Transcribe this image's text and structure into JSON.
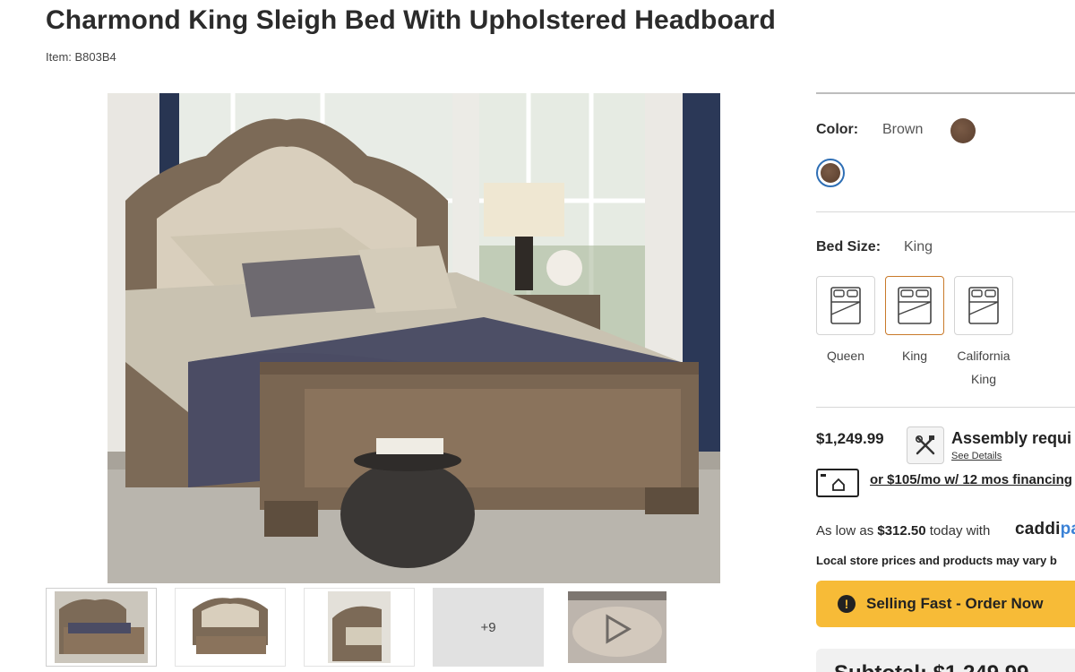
{
  "product": {
    "title": "Charmond King Sleigh Bed With Upholstered Headboard",
    "item_id": "Item: B803B4"
  },
  "gallery": {
    "more_label": "+9"
  },
  "options": {
    "color": {
      "label": "Color:",
      "value": "Brown",
      "swatch_hex": "#6b4c3b"
    },
    "bed_size": {
      "label": "Bed Size:",
      "value": "King",
      "choices": [
        {
          "name": "Queen",
          "selected": false
        },
        {
          "name": "King",
          "selected": true
        },
        {
          "name": "California",
          "name2": "King",
          "selected": false
        }
      ]
    }
  },
  "pricing": {
    "price": "$1,249.99",
    "assembly": "Assembly requi",
    "see_details": "See Details",
    "financing": "or $105/mo w/ 12 mos financing",
    "caddi_prefix": "As low as ",
    "caddi_amount": "$312.50",
    "caddi_suffix": " today with",
    "caddi_logo_a": "caddi",
    "caddi_logo_b": "pa",
    "local_note": "Local store prices and products may vary b",
    "selling_fast": "Selling Fast - Order Now",
    "subtotal": "Subtotal: $1,249.99"
  },
  "colors": {
    "accent_orange": "#c97a2a",
    "selling_yellow": "#f7bb37",
    "swatch_ring_blue": "#2f6fb5"
  }
}
